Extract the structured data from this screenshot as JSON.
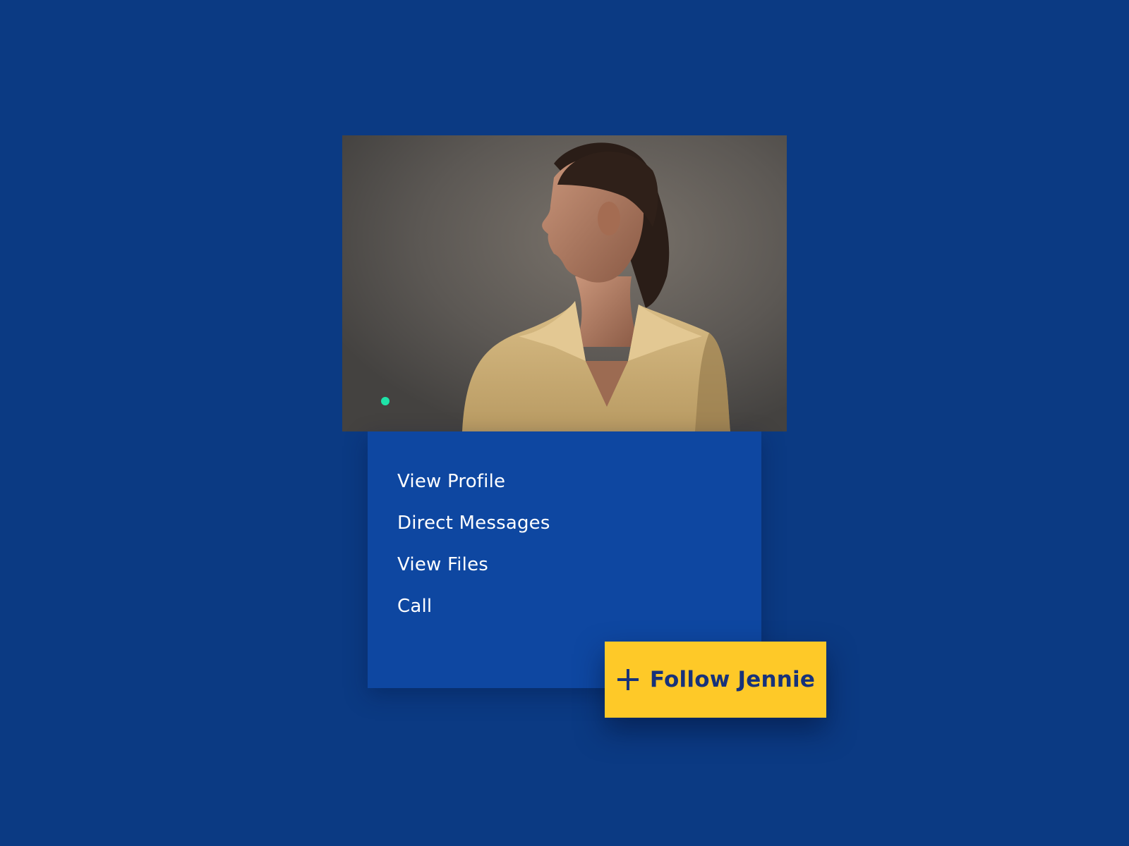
{
  "profile": {
    "photo_icon": "portrait-photo",
    "status": "online",
    "status_color": "#1ee3a8"
  },
  "menu": {
    "items": [
      {
        "label": "View Profile"
      },
      {
        "label": "Direct Messages"
      },
      {
        "label": "View Files"
      },
      {
        "label": "Call"
      }
    ]
  },
  "follow_button": {
    "icon": "plus-icon",
    "label": "Follow Jennie",
    "color": "#fec928"
  },
  "colors": {
    "background": "#0b3a83",
    "menu_panel": "#0e47a1",
    "button_text": "#17327a"
  }
}
